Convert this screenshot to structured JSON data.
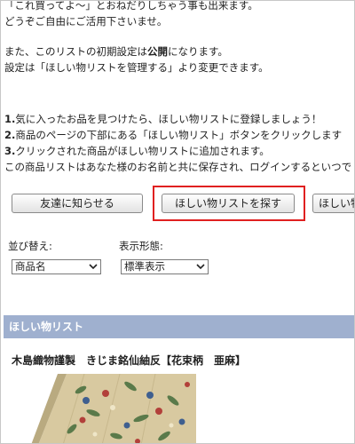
{
  "intro": {
    "line1": "「これ買ってよ～」とおねだりしちゃう事も出来ます。",
    "line2": "どうぞご自由にご活用下さいませ。",
    "line3_prefix": "また、このリストの初期設定は",
    "line3_bold": "公開",
    "line3_suffix": "になります。",
    "line4": "設定は「ほしい物リストを管理する」より変更できます。"
  },
  "steps": [
    {
      "num": "1.",
      "text": "気に入ったお品を見つけたら、ほしい物リストに登録しましょう！"
    },
    {
      "num": "2.",
      "text": "商品のページの下部にある「ほしい物リスト」ボタンをクリックします"
    },
    {
      "num": "3.",
      "text": "クリックされた商品がほしい物リストに追加されます。"
    }
  ],
  "steps_note": "この商品リストはあなた様のお名前と共に保存され、ログインするといつで",
  "buttons": {
    "notify": "友達に知らせる",
    "find": "ほしい物リストを探す",
    "manage": "ほしい物"
  },
  "sort": {
    "label": "並び替え:",
    "selected": "商品名"
  },
  "view": {
    "label": "表示形態:",
    "selected": "標準表示"
  },
  "panel": {
    "title": "ほしい物リスト"
  },
  "product": {
    "title": "木島織物謹製　きじま銘仙紬反【花束柄　亜麻】"
  },
  "colors": {
    "panel_header": "#9fb0cf",
    "highlight": "#e02020"
  }
}
